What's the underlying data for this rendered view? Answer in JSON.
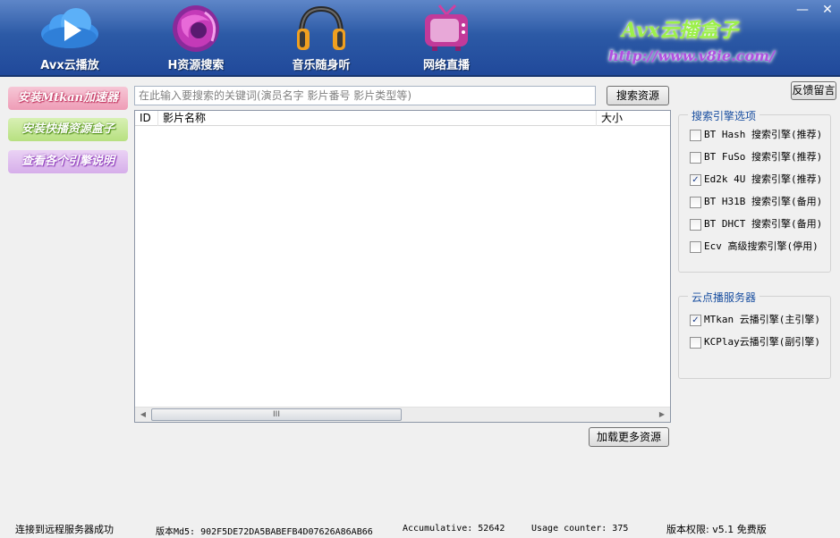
{
  "header": {
    "nav": [
      {
        "label": "Avx云播放",
        "icon": "cloud-play-icon"
      },
      {
        "label": "H资源搜索",
        "icon": "browser-globe-icon"
      },
      {
        "label": "音乐随身听",
        "icon": "headphones-icon"
      },
      {
        "label": "网络直播",
        "icon": "tv-icon"
      }
    ],
    "brand_title": "Avx云播盒子",
    "brand_url": "http://www.v8ie.com/",
    "minimize_glyph": "—",
    "close_glyph": "✕"
  },
  "promos": {
    "mtkan": "安装Mtkan加速器",
    "kuaibo": "安装快播资源盒子",
    "engines": "查看各个引擎说明"
  },
  "search": {
    "placeholder": "在此输入要搜索的关键词(演员名字 影片番号 影片类型等)",
    "button_label": "搜索资源"
  },
  "feedback_label": "反馈留言",
  "table": {
    "columns": [
      "ID",
      "影片名称",
      "大小"
    ],
    "rows": [],
    "scroll_thumb_glyph": "III",
    "scroll_left_glyph": "◀",
    "scroll_right_glyph": "▶"
  },
  "load_more_label": "加载更多资源",
  "engines_group": {
    "title": "搜索引擎选项",
    "options": [
      {
        "label": "BT Hash 搜索引擎(推荐)",
        "checked": false
      },
      {
        "label": "BT FuSo 搜索引擎(推荐)",
        "checked": false
      },
      {
        "label": "Ed2k 4U 搜索引擎(推荐)",
        "checked": true
      },
      {
        "label": "BT H31B 搜索引擎(备用)",
        "checked": false
      },
      {
        "label": "BT DHCT 搜索引擎(备用)",
        "checked": false
      },
      {
        "label": "Ecv 高级搜索引擎(停用)",
        "checked": false
      }
    ]
  },
  "cloud_group": {
    "title": "云点播服务器",
    "options": [
      {
        "label": "MTkan 云播引擎(主引擎)",
        "checked": true
      },
      {
        "label": "KCPlay云播引擎(副引擎)",
        "checked": false
      }
    ]
  },
  "status": {
    "connection": "连接到远程服务器成功",
    "md5": "版本Md5: 902F5DE72DA5BABEFB4D07626A86AB66",
    "accumulative": "Accumulative: 52642",
    "usage": "Usage counter: 375",
    "version": "版本权限:  v5.1 免费版"
  },
  "colors": {
    "header_top": "#5e86c8",
    "header_bottom": "#20489a",
    "group_title": "#1a4fa0"
  }
}
